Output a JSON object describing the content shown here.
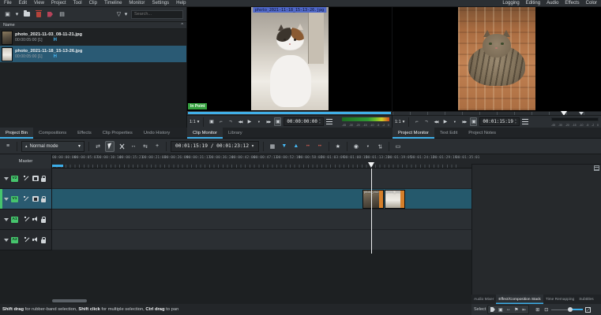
{
  "menu": {
    "items": [
      "File",
      "Edit",
      "View",
      "Project",
      "Tool",
      "Clip",
      "Timeline",
      "Monitor",
      "Settings",
      "Help"
    ],
    "workspaces": [
      "Logging",
      "Editing",
      "Audio",
      "Effects",
      "Color"
    ]
  },
  "icons": {
    "chevron_down": "▾",
    "add_clip": "▣",
    "view_mode": "▤",
    "filter": "▽",
    "collapse": "^",
    "zone_box": "▣",
    "in_point": "⌐",
    "out_point": "¬",
    "rewind": "◀◀",
    "play": "▶",
    "forward": "▶▶",
    "zone_fit": "▣",
    "spin_up": "▴",
    "spin_down": "▾",
    "track_config": "≡",
    "mode_glyph": "▴",
    "mix": "⇄",
    "spacer": "↔",
    "slip": "⇆",
    "multicam": "+",
    "grid": "▦",
    "insert_zone": "▼",
    "overwrite_zone": "▲",
    "extract_dots": "••",
    "star": "★",
    "record": "◉",
    "mixer": "⇄",
    "render": "▭",
    "save": "▣",
    "resize": "↔",
    "flag": "⚑",
    "marker": "⇤",
    "fit_zoom": "⊞",
    "zoom_box": "⊡"
  },
  "bin": {
    "search_placeholder": "Search...",
    "header_name": "Name",
    "clips": [
      {
        "name": "photo_2021-11-03_08-11-21.jpg",
        "duration": "00:00:05:00 [1]",
        "badge": "H"
      },
      {
        "name": "photo_2021-11-18_15-13-26.jpg",
        "duration": "00:00:05:00 [1]",
        "badge": "H"
      }
    ]
  },
  "clip_monitor": {
    "overlay_filename": "photo_2021-11-18_15-13-26.jpg",
    "in_point_label": "In Point",
    "zoom_level": "1:1",
    "timecode": "00:00:00:00"
  },
  "project_monitor": {
    "zoom_level": "1:1",
    "timecode": "00:01:15:19"
  },
  "audio_meter_labels": [
    "-45",
    "-30",
    "-20",
    "-15",
    "-10",
    "-5",
    "-2",
    "0"
  ],
  "tabs_left": [
    "Project Bin",
    "Compositions",
    "Effects",
    "Clip Properties",
    "Undo History"
  ],
  "tabs_mid": [
    "Clip Monitor",
    "Library"
  ],
  "tabs_right": [
    "Project Monitor",
    "Text Edit",
    "Project Notes"
  ],
  "right_tabs": [
    "Audio Mixer",
    "Effect/Composition Stack",
    "Time Remapping",
    "Subtitles"
  ],
  "timeline": {
    "mode_label": "Normal mode",
    "timecode_display": "00:01:15:19 / 00:01:23:12",
    "master_label": "Master",
    "ruler_ticks": [
      "00:00:00:00",
      "00:00:05:07",
      "00:00:10:14",
      "00:00:15:21",
      "00:00:21:03",
      "00:00:26:09",
      "00:00:31:17",
      "00:00:36:24",
      "00:00:42:06",
      "00:00:47:13",
      "00:00:52:19",
      "00:00:58:02",
      "00:01:03:09",
      "00:01:08:15",
      "00:01:13:23",
      "00:01:19:05",
      "00:01:24:12",
      "00:01:29:19",
      "00:01:35:01"
    ],
    "tracks": [
      {
        "id": "V2"
      },
      {
        "id": "V1"
      },
      {
        "id": "A1"
      },
      {
        "id": "A2"
      }
    ],
    "clips": [
      {
        "label": "photo_2021"
      },
      {
        "label": "photo_2021"
      }
    ]
  },
  "status": {
    "hint_bold_1": "Shift drag",
    "hint_text_1": " for rubber-band selection, ",
    "hint_bold_2": "Shift click",
    "hint_text_2": " for multiple selection, ",
    "hint_bold_3": "Ctrl drag",
    "hint_text_3": " to pan",
    "select_label": "Select"
  }
}
